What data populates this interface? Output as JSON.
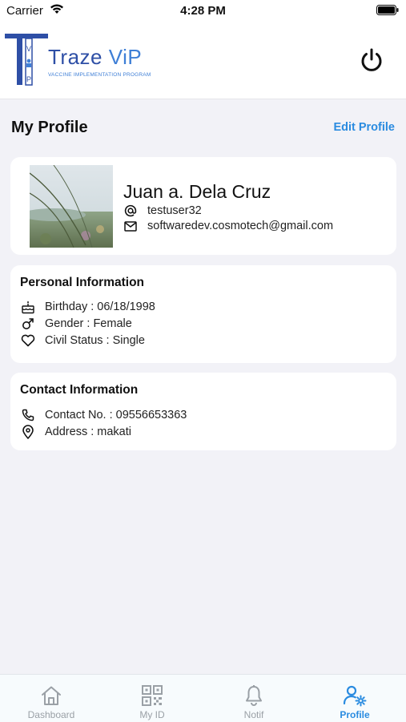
{
  "status_bar": {
    "carrier": "Carrier",
    "time": "4:28 PM"
  },
  "header": {
    "logo_title": "Traze",
    "logo_title_accent": "ViP",
    "logo_subtitle": "VACCINE IMPLEMENTATION PROGRAM",
    "logo_letters": "VIP",
    "power_icon": "power-icon"
  },
  "page": {
    "title": "My Profile",
    "edit_label": "Edit Profile"
  },
  "profile": {
    "name": "Juan a. Dela Cruz",
    "username": "testuser32",
    "email": "softwaredev.cosmotech@gmail.com",
    "username_icon": "at-icon",
    "email_icon": "mail-icon"
  },
  "personal_info": {
    "title": "Personal Information",
    "items": [
      {
        "icon": "cake-icon",
        "text": "Birthday : 06/18/1998"
      },
      {
        "icon": "gender-male-icon",
        "text": "Gender : Female"
      },
      {
        "icon": "heart-icon",
        "text": "Civil Status : Single"
      }
    ]
  },
  "contact_info": {
    "title": "Contact Information",
    "items": [
      {
        "icon": "phone-icon",
        "text": "Contact No. : 09556653363"
      },
      {
        "icon": "location-pin-icon",
        "text": "Address : makati"
      }
    ]
  },
  "tabs": [
    {
      "label": "Dashboard",
      "icon": "home-icon",
      "active": false
    },
    {
      "label": "My ID",
      "icon": "qr-code-icon",
      "active": false
    },
    {
      "label": "Notif",
      "icon": "bell-icon",
      "active": false
    },
    {
      "label": "Profile",
      "icon": "profile-settings-icon",
      "active": true
    }
  ],
  "colors": {
    "accent": "#2a8be0",
    "brand_dark": "#2e4fa6",
    "background": "#f2f2f7"
  }
}
